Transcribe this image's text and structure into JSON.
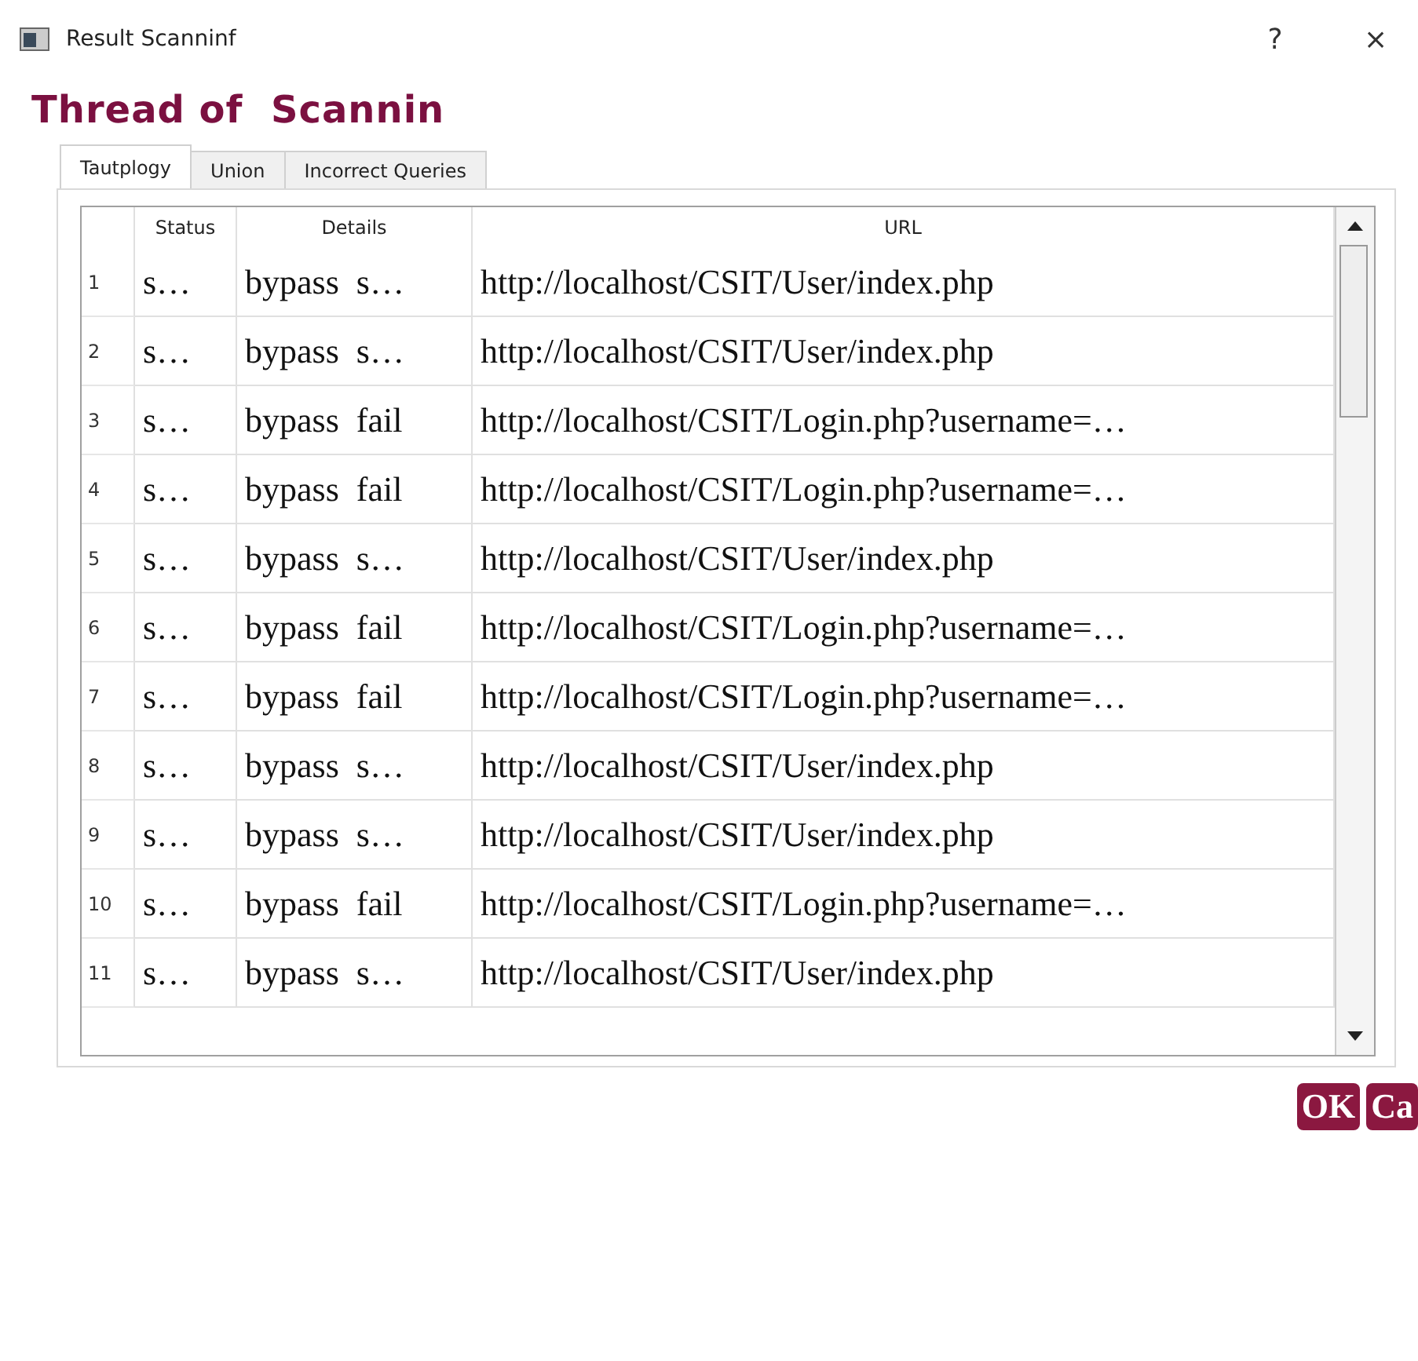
{
  "window": {
    "title": "Result Scanninf",
    "help": "?",
    "close": "×"
  },
  "heading": "Thread of  Scannin",
  "tabs": [
    {
      "label": "Tautplogy",
      "selected": true
    },
    {
      "label": "Union",
      "selected": false
    },
    {
      "label": "Incorrect Queries",
      "selected": false
    }
  ],
  "table": {
    "columns": [
      "Status",
      "Details",
      "URL"
    ],
    "rows": [
      {
        "index": "1",
        "status": "s…",
        "details": "bypass  s…",
        "url": "http://localhost/CSIT/User/index.php"
      },
      {
        "index": "2",
        "status": "s…",
        "details": "bypass  s…",
        "url": "http://localhost/CSIT/User/index.php"
      },
      {
        "index": "3",
        "status": "s…",
        "details": "bypass  fail",
        "url": "http://localhost/CSIT/Login.php?username=…"
      },
      {
        "index": "4",
        "status": "s…",
        "details": "bypass  fail",
        "url": "http://localhost/CSIT/Login.php?username=…"
      },
      {
        "index": "5",
        "status": "s…",
        "details": "bypass  s…",
        "url": "http://localhost/CSIT/User/index.php"
      },
      {
        "index": "6",
        "status": "s…",
        "details": "bypass  fail",
        "url": "http://localhost/CSIT/Login.php?username=…"
      },
      {
        "index": "7",
        "status": "s…",
        "details": "bypass  fail",
        "url": "http://localhost/CSIT/Login.php?username=…"
      },
      {
        "index": "8",
        "status": "s…",
        "details": "bypass  s…",
        "url": "http://localhost/CSIT/User/index.php"
      },
      {
        "index": "9",
        "status": "s…",
        "details": "bypass  s…",
        "url": "http://localhost/CSIT/User/index.php"
      },
      {
        "index": "10",
        "status": "s…",
        "details": "bypass  fail",
        "url": "http://localhost/CSIT/Login.php?username=…"
      },
      {
        "index": "11",
        "status": "s…",
        "details": "bypass  s…",
        "url": "http://localhost/CSIT/User/index.php"
      }
    ]
  },
  "buttons": [
    "OK",
    "Ca"
  ]
}
